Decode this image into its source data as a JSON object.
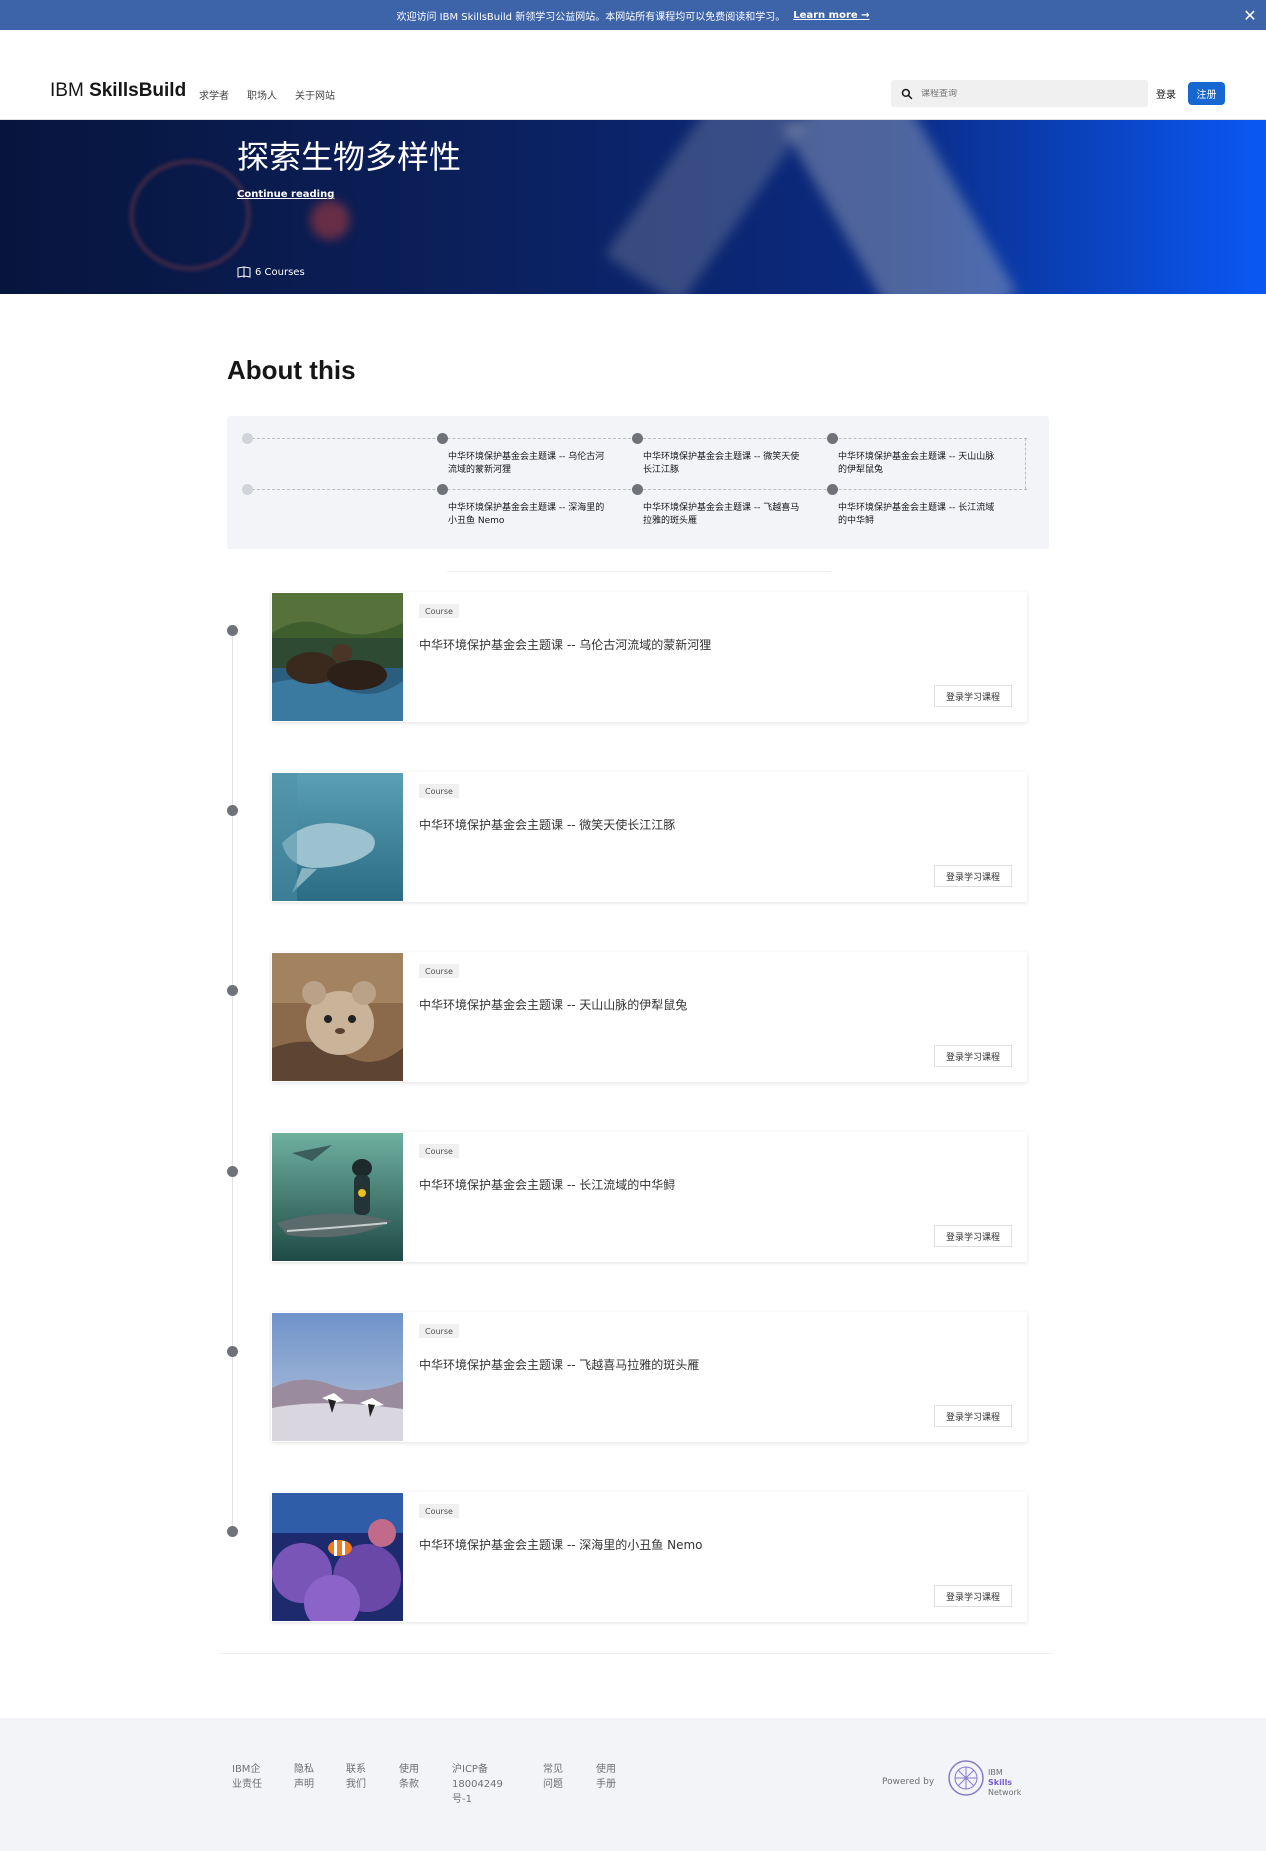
{
  "banner": {
    "text": "欢迎访问 IBM SkillsBuild 新领学习公益网站。本网站所有课程均可以免费阅读和学习。",
    "link": "Learn more →"
  },
  "header": {
    "logo_light": "IBM",
    "logo_bold": "SkillsBuild",
    "nav": [
      "求学者",
      "职场人",
      "关于网站"
    ],
    "search_placeholder": "课程查询",
    "login": "登录",
    "signup": "注册"
  },
  "hero": {
    "title": "探索生物多样性",
    "link": "Continue reading",
    "courses": "6 Courses"
  },
  "about": {
    "heading": "About this"
  },
  "roadmap": {
    "items": [
      "中华环境保护基金会主题课 -- 乌伦古河流域的蒙新河狸",
      "中华环境保护基金会主题课 -- 微笑天使长江江豚",
      "中华环境保护基金会主题课 -- 天山山脉的伊犁鼠兔",
      "中华环境保护基金会主题课 -- 深海里的小丑鱼 Nemo",
      "中华环境保护基金会主题课 -- 飞越喜马拉雅的斑头雁",
      "中华环境保护基金会主题课 -- 长江流域的中华鲟"
    ]
  },
  "courses": [
    {
      "tag": "Course",
      "title": "中华环境保护基金会主题课 -- 乌伦古河流域的蒙新河狸",
      "button": "登录学习课程"
    },
    {
      "tag": "Course",
      "title": "中华环境保护基金会主题课 -- 微笑天使长江江豚",
      "button": "登录学习课程"
    },
    {
      "tag": "Course",
      "title": "中华环境保护基金会主题课 -- 天山山脉的伊犁鼠兔",
      "button": "登录学习课程"
    },
    {
      "tag": "Course",
      "title": "中华环境保护基金会主题课 -- 长江流域的中华鲟",
      "button": "登录学习课程"
    },
    {
      "tag": "Course",
      "title": "中华环境保护基金会主题课 -- 飞越喜马拉雅的斑头雁",
      "button": "登录学习课程"
    },
    {
      "tag": "Course",
      "title": "中华环境保护基金会主题课 -- 深海里的小丑鱼 Nemo",
      "button": "登录学习课程"
    }
  ],
  "footer": {
    "links": [
      "IBM企\n业责任",
      "隐私\n声明",
      "联系\n我们",
      "使用\n条款",
      "沪ICP备\n18004249\n号-1",
      "常见\n问题",
      "使用\n手册"
    ],
    "powered_by": "Powered by",
    "logo_line1": "IBM",
    "logo_line2": "Skills",
    "logo_line3": "Network"
  }
}
